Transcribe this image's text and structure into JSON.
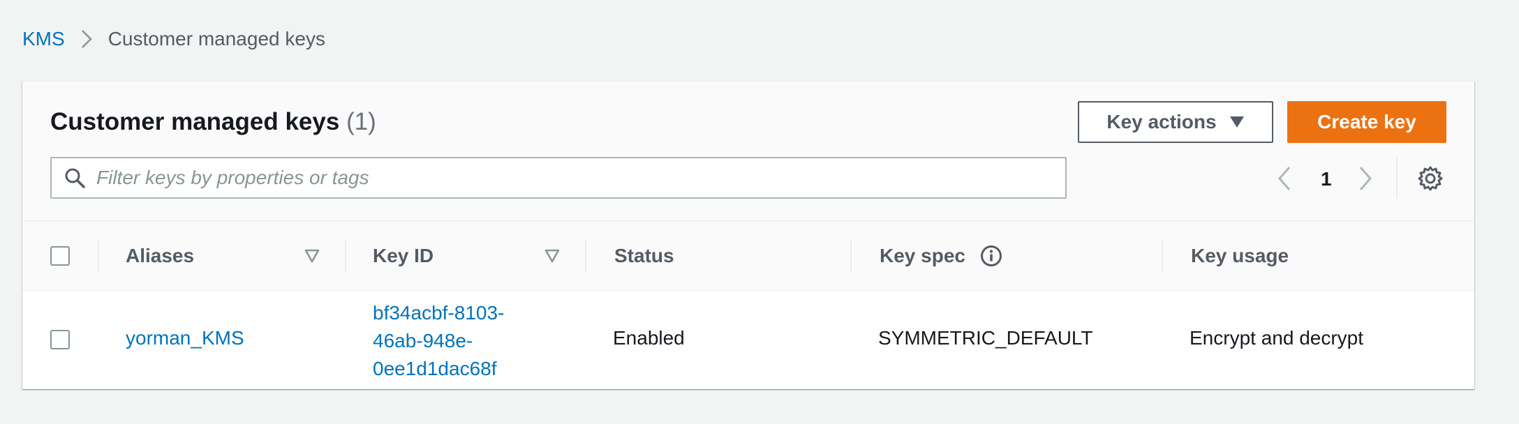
{
  "breadcrumb": {
    "root": "KMS",
    "current": "Customer managed keys"
  },
  "header": {
    "title": "Customer managed keys",
    "count": "(1)",
    "key_actions_label": "Key actions",
    "create_key_label": "Create key"
  },
  "search": {
    "placeholder": "Filter keys by properties or tags",
    "value": ""
  },
  "pagination": {
    "current_page": "1"
  },
  "table": {
    "columns": [
      "Aliases",
      "Key ID",
      "Status",
      "Key spec",
      "Key usage"
    ],
    "rows": [
      {
        "alias": "yorman_KMS",
        "key_id_lines": [
          "bf34acbf-8103-",
          "46ab-948e-",
          "0ee1d1dac68f"
        ],
        "status": "Enabled",
        "key_spec": "SYMMETRIC_DEFAULT",
        "key_usage": "Encrypt and decrypt"
      }
    ]
  },
  "colors": {
    "link": "#0073bb",
    "primary_button": "#ec7211",
    "background": "#f2f3f3"
  },
  "icons": [
    "chevron-right-icon",
    "caret-down-icon",
    "search-icon",
    "chevron-left-icon",
    "gear-icon",
    "sort-triangle-icon",
    "info-icon"
  ]
}
